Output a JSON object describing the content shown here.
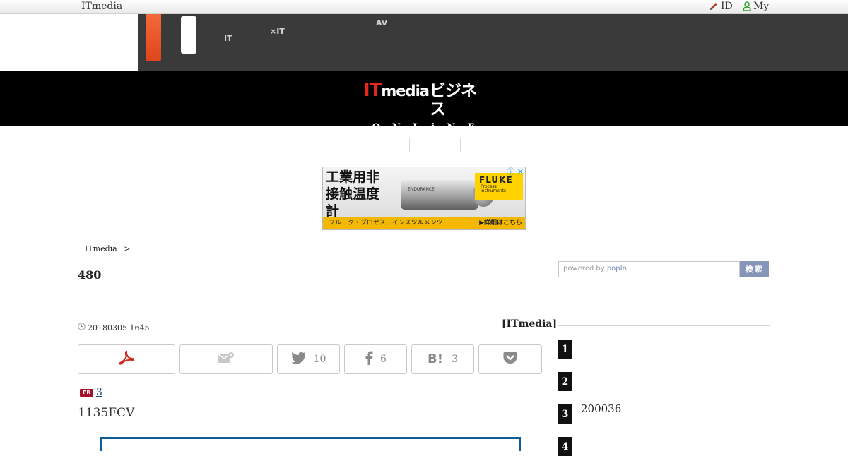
{
  "topbar": {
    "brand": "ITmedia",
    "id_label": "ID",
    "my_label": "My"
  },
  "nav": {
    "item1": [
      "",
      "IT"
    ],
    "item2": [
      "",
      "×IT"
    ],
    "item3": [
      "AV",
      ""
    ]
  },
  "logo": {
    "it": "IT",
    "media": "media",
    "biz": "ビジネス",
    "online": [
      "O",
      "N",
      "L",
      "i",
      "N",
      "E"
    ]
  },
  "ad": {
    "headline": "工業用非接触温度計",
    "device_label": "ENDURANCE",
    "brand": "FLUKE",
    "brand_sub": "Process Instruments",
    "bar_text": "フルーク・プロセス・インスツルメンツ",
    "bar_more": "▶詳細はこちら",
    "close": "ⓘ ✕"
  },
  "breadcrumb": {
    "home": "ITmedia",
    "sep": ">"
  },
  "article": {
    "title": "480",
    "date": "20180305 1645",
    "author": "[ITmedia]",
    "pr_badge": "PR",
    "pr_link": "3",
    "body_lead": "1135FCV"
  },
  "share": {
    "twitter_count": "10",
    "facebook_count": "6",
    "hatena_count": "3"
  },
  "search": {
    "placeholder_prefix": "powered by ",
    "placeholder_brand": "popIn",
    "button": "検索"
  },
  "ranking": [
    {
      "rank": "1",
      "text": ""
    },
    {
      "rank": "2",
      "text": ""
    },
    {
      "rank": "3",
      "text": "200036"
    },
    {
      "rank": "4",
      "text": ""
    }
  ],
  "colors": {
    "accent_orange": "#e0441a",
    "logo_red": "#e8251b",
    "search_button": "#8796b8",
    "pr_badge": "#a6112c",
    "box_border": "#0e5d96"
  }
}
